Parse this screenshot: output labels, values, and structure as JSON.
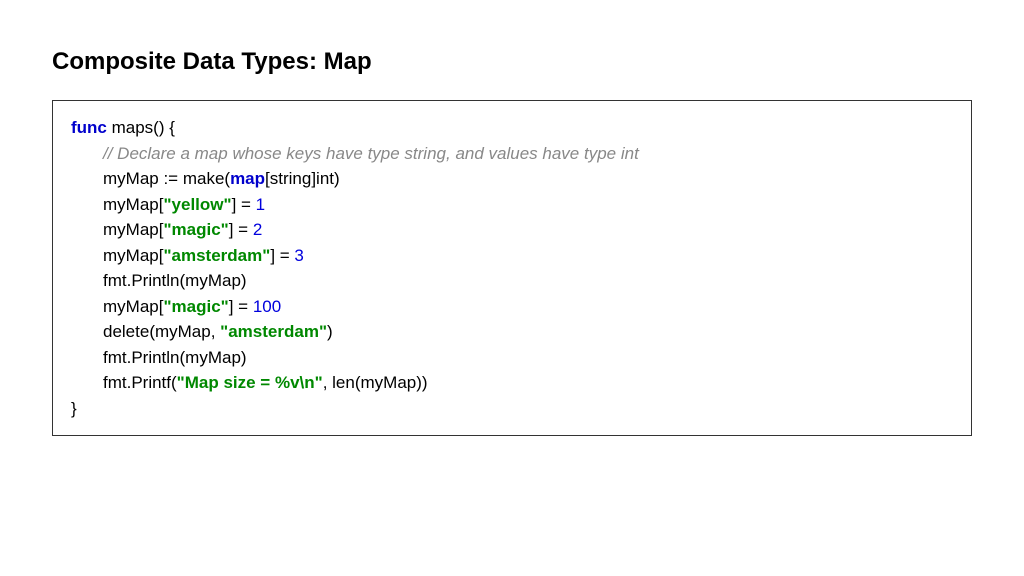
{
  "slide": {
    "title": "Composite Data Types: Map"
  },
  "code": {
    "line1": {
      "kw_func": "func",
      "rest": " maps() {"
    },
    "line2": {
      "comment": "// Declare a map whose keys have type string, and values have type int"
    },
    "line3": {
      "part1": "myMap := make(",
      "kw_map": "map",
      "part2": "[string]int)"
    },
    "line4": {
      "part1": "myMap[",
      "str": "\"yellow\"",
      "part2": "] = ",
      "num": "1"
    },
    "line5": {
      "part1": "myMap[",
      "str": "\"magic\"",
      "part2": "] = ",
      "num": "2"
    },
    "line6": {
      "part1": "myMap[",
      "str": "\"amsterdam\"",
      "part2": "] = ",
      "num": "3"
    },
    "line7": {
      "text": "fmt.Println(myMap)"
    },
    "line8": {
      "part1": "myMap[",
      "str": "\"magic\"",
      "part2": "] = ",
      "num": "100"
    },
    "line9": {
      "part1": "delete(myMap, ",
      "str": "\"amsterdam\"",
      "part2": ")"
    },
    "line10": {
      "text": "fmt.Println(myMap)"
    },
    "line11": {
      "part1": "fmt.Printf(",
      "str": "\"Map size = %v\\n\"",
      "part2": ", len(myMap))"
    },
    "line12": {
      "text": "}"
    }
  }
}
